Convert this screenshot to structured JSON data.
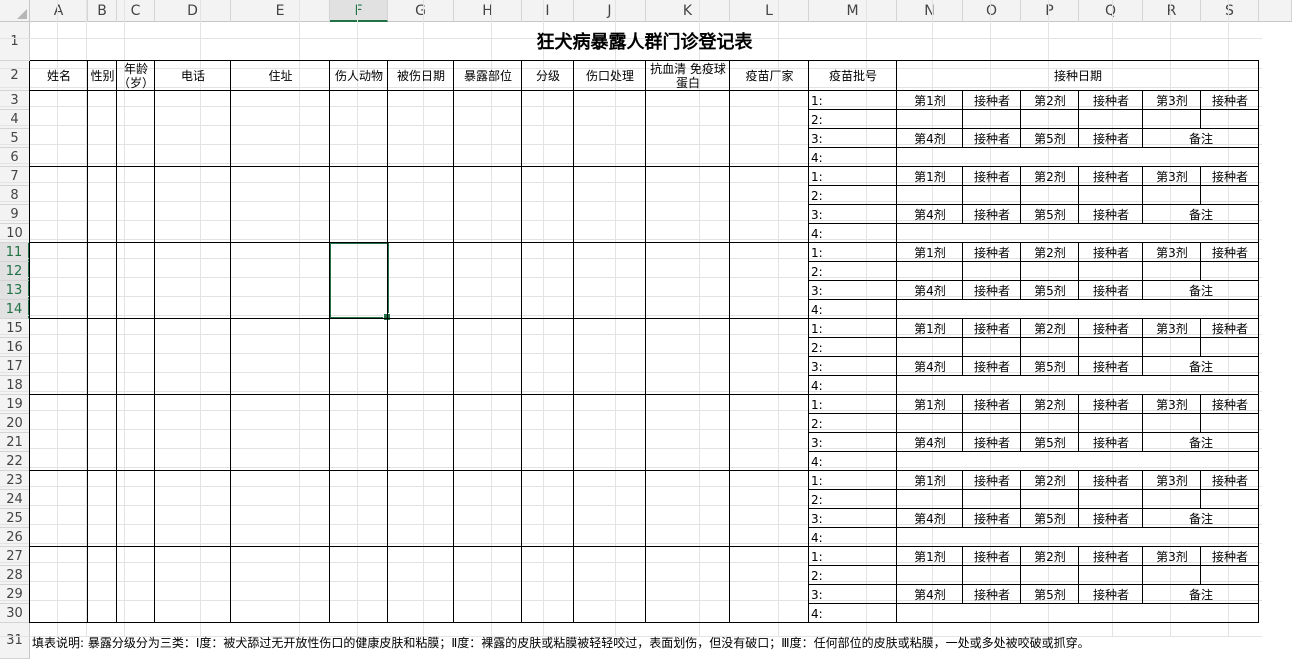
{
  "sheet": {
    "columns": [
      "A",
      "B",
      "C",
      "D",
      "E",
      "F",
      "G",
      "H",
      "I",
      "J",
      "K",
      "L",
      "M",
      "N",
      "O",
      "P",
      "Q",
      "R",
      "S"
    ],
    "selected_column": "F",
    "selected_rows": [
      "11",
      "12",
      "13",
      "14"
    ],
    "title": "狂犬病暴露人群门诊登记表",
    "headers": {
      "name": "姓名",
      "sex": "性别",
      "age_1": "年龄",
      "age_2": "（岁）",
      "phone": "电话",
      "address": "住址",
      "animal": "伤人动物",
      "injury_date": "被伤日期",
      "site": "暴露部位",
      "grade": "分级",
      "wound": "伤口处理",
      "serum_1": "抗血清 免疫球",
      "serum_2": "蛋白",
      "maker": "疫苗厂家",
      "batch": "疫苗批号",
      "vacc_date": "接种日期"
    },
    "block": {
      "batch_labels": [
        "1:",
        "2:",
        "3:",
        "4:"
      ],
      "row_a": [
        "第1剂",
        "接种者",
        "第2剂",
        "接种者",
        "第3剂",
        "接种者"
      ],
      "row_c": [
        "第4剂",
        "接种者",
        "第5剂",
        "接种者",
        "备注"
      ]
    },
    "note": "填表说明: 暴露分级分为三类：Ⅰ度：被犬舔过无开放性伤口的健康皮肤和粘膜；Ⅱ度：裸露的皮肤或粘膜被轻轻咬过，表面划伤，但没有破口；Ⅲ度：任何部位的皮肤或粘膜，一处或多处被咬破或抓穿。",
    "colors": {
      "accent": "#217346",
      "grid": "#e3e3e3",
      "header_bg": "#f3f3f3"
    }
  }
}
